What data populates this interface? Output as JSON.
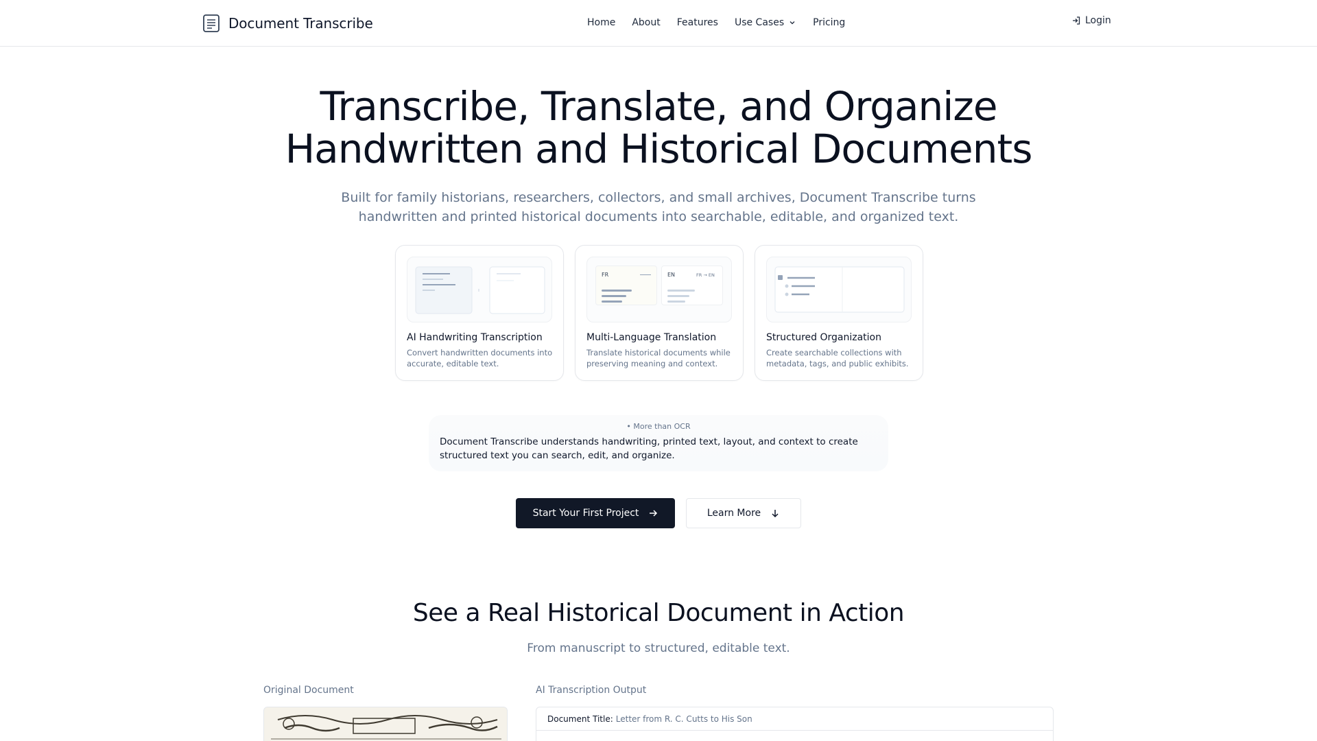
{
  "brand": {
    "name": "Document Transcribe",
    "icon": "document-lines-icon"
  },
  "nav": {
    "items": [
      "Home",
      "About",
      "Features"
    ],
    "dropdown_label": "Use Cases",
    "pricing": "Pricing",
    "login": "Login"
  },
  "hero": {
    "title_line1": "Transcribe, Translate, and Organize",
    "title_line2": "Handwritten and Historical Documents",
    "subtitle": "Built for family historians, researchers, collectors, and small archives, Document Transcribe turns handwritten and printed historical documents into searchable, editable, and organized text."
  },
  "features": [
    {
      "title": "AI Handwriting Transcription",
      "description": "Convert handwritten documents into accurate, editable text."
    },
    {
      "title": "Multi-Language Translation",
      "description": "Translate historical documents while preserving meaning and context.",
      "preview_lang_from": "FR",
      "preview_lang_to": "EN",
      "preview_pair": "FR → EN"
    },
    {
      "title": "Structured Organization",
      "description": "Create searchable collections with metadata, tags, and public exhibits."
    }
  ],
  "ocr": {
    "tag": "• More than OCR",
    "text": "Document Transcribe understands handwriting, printed text, layout, and context to create structured text you can search, edit, and organize."
  },
  "cta": {
    "primary": "Start Your First Project",
    "secondary": "Learn More"
  },
  "demo": {
    "title": "See a Real Historical Document in Action",
    "subtitle": "From manuscript to structured, editable text.",
    "left_label": "Original Document",
    "right_label": "AI Transcription Output",
    "doc_title_label": "Document Title:",
    "doc_title_value": "Letter from R. C. Cutts to His Son"
  },
  "colors": {
    "primary_button": "#111827",
    "muted_text": "#64748b",
    "border": "#e5e7eb"
  }
}
